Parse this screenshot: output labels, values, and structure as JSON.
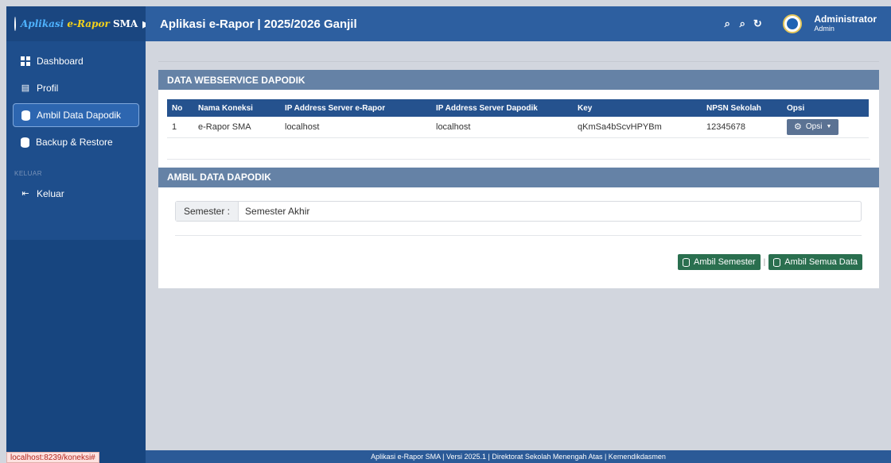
{
  "brand": {
    "part1": "Aplikasi",
    "part2": "e-Rapor",
    "part3": "SMA"
  },
  "header": {
    "title": "Aplikasi e-Rapor | 2025/2026 Ganjil"
  },
  "user": {
    "name": "Administrator",
    "role": "Admin"
  },
  "sidebar": {
    "items": [
      {
        "label": "Dashboard"
      },
      {
        "label": "Profil"
      },
      {
        "label": "Ambil Data Dapodik"
      },
      {
        "label": "Backup & Restore"
      }
    ],
    "section_label": "KELUAR",
    "logout": {
      "label": "Keluar"
    }
  },
  "webservice": {
    "title": "DATA WEBSERVICE DAPODIK",
    "columns": [
      "No",
      "Nama Koneksi",
      "IP Address Server e-Rapor",
      "IP Address Server Dapodik",
      "Key",
      "NPSN Sekolah",
      "Opsi"
    ],
    "rows": [
      {
        "no": "1",
        "nama": "e-Rapor SMA",
        "ip_erapor": "localhost",
        "ip_dapodik": "localhost",
        "key": "qKmSa4bScvHPYBm",
        "npsn": "12345678",
        "opsi": "Opsi"
      }
    ]
  },
  "ambil": {
    "title": "AMBIL DATA DAPODIK",
    "semester_label": "Semester :",
    "semester_value": "Semester Akhir",
    "btn_semester": "Ambil Semester",
    "separator": "|",
    "btn_semua": "Ambil Semua Data"
  },
  "footer": {
    "text": "Aplikasi e-Rapor SMA | Versi 2025.1 | Direktorat Sekolah Menengah Atas | Kemendikdasmen"
  },
  "status_bar": {
    "url": "localhost:8239/koneksi#"
  },
  "colors": {
    "sidebar": "#1f4f8f",
    "topbar": "#2d5fa0",
    "section_header": "#6582a6",
    "table_header": "#25528e",
    "button_green": "#2a6f4f"
  }
}
